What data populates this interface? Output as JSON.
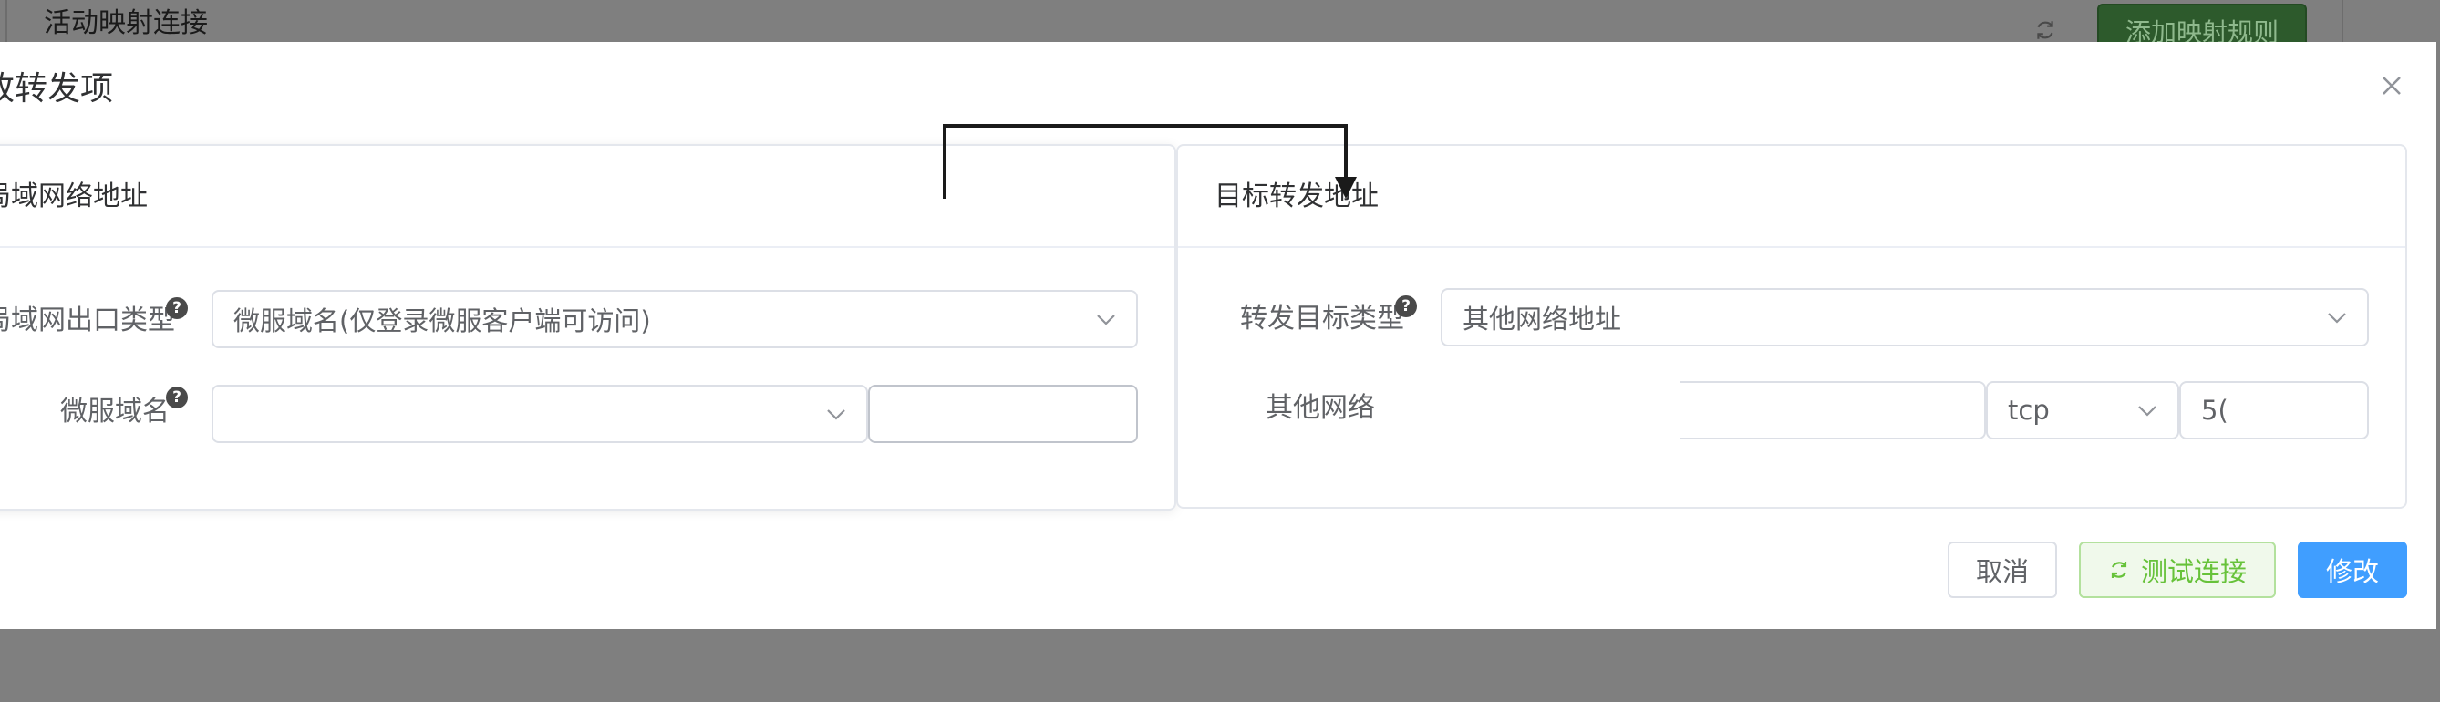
{
  "background": {
    "section_title": "活动映射连接",
    "add_rule_button": "添加映射规则",
    "refresh_icon": "refresh-icon"
  },
  "dialog": {
    "title": "改转发项",
    "close_icon": "close-icon",
    "left_card": {
      "header": "局域网络地址",
      "exit_type_label": "局域网出口类型",
      "exit_type_value": "微服域名(仅登录微服客户端可访问)",
      "domain_label": "微服域名",
      "domain_value": "",
      "domain_suffix_value": ""
    },
    "right_card": {
      "header": "目标转发地址",
      "target_type_label": "转发目标类型",
      "target_type_value": "其他网络地址",
      "other_network_label": "其他网络",
      "address_value": "",
      "protocol_value": "tcp",
      "port_value": "5("
    },
    "footer": {
      "cancel": "取消",
      "test": "测试连接",
      "save": "修改"
    }
  },
  "colors": {
    "primary": "#409eff",
    "success": "#67c23a",
    "overlay": "#7f7f7f",
    "bg_add_button": "#2d5a2c"
  }
}
